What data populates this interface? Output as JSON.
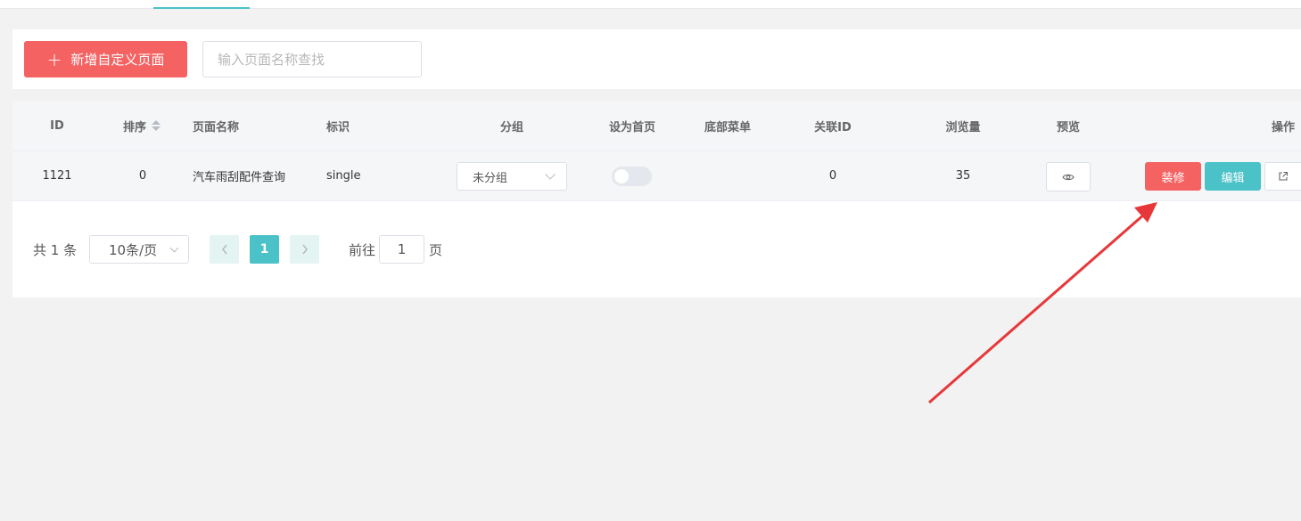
{
  "toolbar": {
    "add_button_label": "新增自定义页面",
    "add_button_icon": "plus-icon",
    "search_placeholder": "输入页面名称查找",
    "search_value": ""
  },
  "table": {
    "headers": [
      "ID",
      "排序",
      "页面名称",
      "标识",
      "分组",
      "设为首页",
      "底部菜单",
      "关联ID",
      "浏览量",
      "预览",
      "操作"
    ],
    "rows": [
      {
        "id": "1121",
        "order": "0",
        "name": "汽车雨刮配件查询",
        "identifier": "single",
        "group": "未分组",
        "set_home": false,
        "bottom_menu": "",
        "related_id": "0",
        "views": "35",
        "preview_icon": "eye-icon",
        "actions": {
          "decorate": "装修",
          "edit": "编辑",
          "share_icon": "external-link-icon"
        }
      }
    ]
  },
  "pagination": {
    "total_text": "共 1 条",
    "page_size": "10条/页",
    "current_page": "1",
    "goto_prefix": "前往",
    "goto_value": "1",
    "goto_suffix": "页"
  },
  "colors": {
    "primary_red": "#f56262",
    "primary_teal": "#4ac2c8",
    "annotation_arrow": "#e8373a"
  }
}
